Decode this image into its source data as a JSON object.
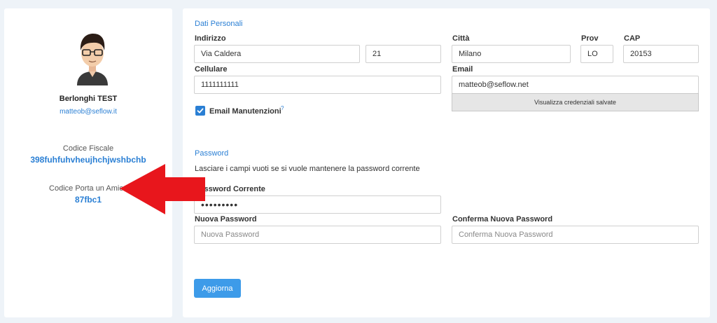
{
  "profile": {
    "name": "Berlonghi TEST",
    "email": "matteob@seflow.it",
    "codice_fiscale_label": "Codice Fiscale",
    "codice_fiscale": "398fuhfuhvheujhchjwshbchb",
    "porta_amico_label": "Codice Porta un Amico",
    "porta_amico": "87fbc1"
  },
  "dati_personali": {
    "title": "Dati Personali",
    "indirizzo_label": "Indirizzo",
    "indirizzo": "Via Caldera",
    "civico": "21",
    "citta_label": "Città",
    "citta": "Milano",
    "prov_label": "Prov",
    "prov": "LO",
    "cap_label": "CAP",
    "cap": "20153",
    "cellulare_label": "Cellulare",
    "cellulare": "1111111111",
    "email_label": "Email",
    "email": "matteob@seflow.net",
    "credenziali_button": "Visualizza credenziali salvate",
    "email_manutenzioni_label": "Email Manutenzioni",
    "email_manutenzioni_checked": true,
    "help_mark": "?"
  },
  "password": {
    "title": "Password",
    "hint": "Lasciare i campi vuoti se si vuole mantenere la password corrente",
    "corrente_label": "Password Corrente",
    "corrente_value": "•••••••••",
    "nuova_label": "Nuova Password",
    "nuova_placeholder": "Nuova Password",
    "conferma_label": "Conferma Nuova Password",
    "conferma_placeholder": "Conferma Nuova Password"
  },
  "actions": {
    "submit": "Aggiorna"
  },
  "colors": {
    "accent": "#2a7fd4",
    "button": "#3d9be9",
    "arrow": "#e8161c"
  }
}
